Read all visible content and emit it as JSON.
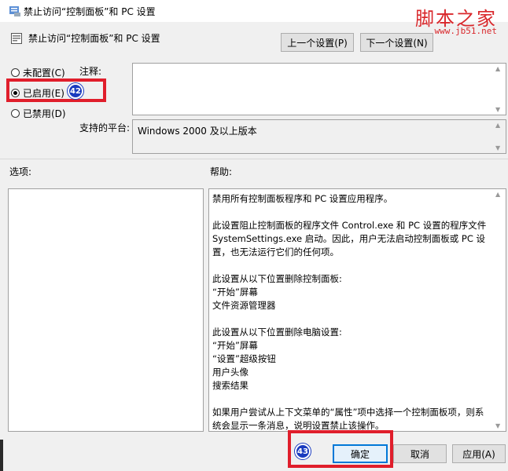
{
  "window": {
    "title": "禁止访问“控制面板”和 PC 设置"
  },
  "watermark": {
    "main": "脚本之家",
    "sub": "www.jb51.net"
  },
  "header": {
    "policy_name": "禁止访问“控制面板”和 PC 设置",
    "prev_button": "上一个设置(P)",
    "next_button": "下一个设置(N)"
  },
  "state": {
    "options": [
      {
        "label": "未配置(C)",
        "checked": false
      },
      {
        "label": "已启用(E)",
        "checked": true
      },
      {
        "label": "已禁用(D)",
        "checked": false
      }
    ]
  },
  "comment": {
    "label": "注释:",
    "value": ""
  },
  "platform": {
    "label": "支持的平台:",
    "value": "Windows 2000 及以上版本"
  },
  "options_panel": {
    "label": "选项:"
  },
  "help_panel": {
    "label": "帮助:",
    "text": "禁用所有控制面板程序和 PC 设置应用程序。\n\n此设置阻止控制面板的程序文件 Control.exe 和 PC 设置的程序文件 SystemSettings.exe 启动。因此，用户无法启动控制面板或 PC 设置，也无法运行它们的任何项。\n\n此设置从以下位置删除控制面板:\n“开始”屏幕\n文件资源管理器\n\n此设置从以下位置删除电脑设置:\n“开始”屏幕\n“设置”超级按钮\n用户头像\n搜索结果\n\n如果用户尝试从上下文菜单的“属性”项中选择一个控制面板项，则系统会显示一条消息，说明设置禁止该操作。"
  },
  "footer": {
    "ok": "确定",
    "cancel": "取消",
    "apply": "应用(A)"
  },
  "annotations": {
    "badge_1": "42",
    "badge_2": "43"
  },
  "colors": {
    "highlight": "#e01e2b",
    "badge": "#1a3bbf",
    "watermark": "#d9272b"
  }
}
